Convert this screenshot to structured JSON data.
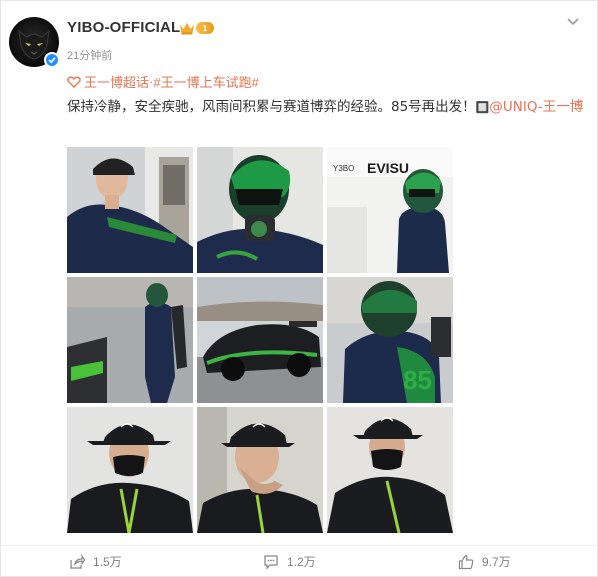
{
  "user": {
    "name": "YIBO-OFFICIAL",
    "vip_level": "1",
    "time": "21分钟前"
  },
  "post": {
    "topic1": "王一博超话",
    "topic_separator": " · ",
    "topic2": "#王一博上车试跑#",
    "text": "保持冷静，安全疾驰，风雨间积累与赛道博弈的经验。85号再出发！",
    "mention_prefix": "🔲",
    "mention": "@UNIQ-王一博"
  },
  "images": [
    {
      "desc": "driver-at-pit-wall"
    },
    {
      "desc": "driver-green-helmet"
    },
    {
      "desc": "driver-near-truck"
    },
    {
      "desc": "driver-pitlane-walk"
    },
    {
      "desc": "race-car-audi"
    },
    {
      "desc": "driver-back-85"
    },
    {
      "desc": "portrait-cap-mask-1"
    },
    {
      "desc": "portrait-cap-mask-2"
    },
    {
      "desc": "portrait-cap-mask-3"
    }
  ],
  "image_texts": {
    "truck_sign": "EVISU",
    "truck_sign_small": "Y3BO",
    "race_number": "85"
  },
  "actions": {
    "share": "1.5万",
    "comment": "1.2万",
    "like": "9.7万"
  },
  "colors": {
    "accent": "#eb7350",
    "verified": "#1e90ff",
    "vip_gold": "#f0aa2c",
    "text": "#333333",
    "muted": "#939393"
  },
  "icons": [
    "panther-avatar",
    "verified-icon",
    "crown-icon",
    "chevron-down-icon",
    "topic-icon",
    "share-icon",
    "comment-icon",
    "like-icon"
  ]
}
